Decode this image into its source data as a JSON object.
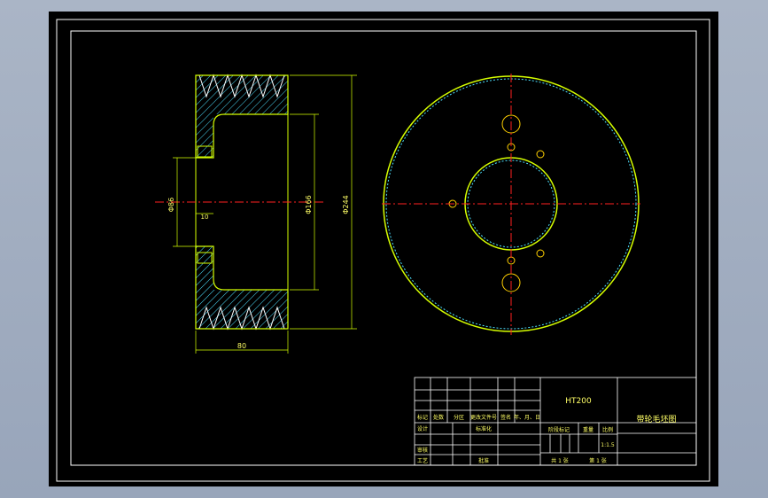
{
  "drawing": {
    "material": "HT200",
    "title": "带轮毛坯图",
    "scale": "1:1.5",
    "sheet_total": "共 1 张",
    "sheet_no": "第 1 张"
  },
  "dimensions": {
    "overall_diameter": "Φ244",
    "bore_diameter": "Φ166",
    "hub_diameter": "Φ86",
    "hub_offset": "10",
    "width": "80"
  },
  "title_block": {
    "mark": "标记",
    "count": "处数",
    "zone": "分区",
    "change_doc": "更改文件号",
    "signature": "签名",
    "date": "年、月、日",
    "design": "设计",
    "standardize": "标准化",
    "review": "审核",
    "process": "工艺",
    "approve": "批准",
    "stage_mark": "阶段标记",
    "weight": "重量",
    "ratio": "比例"
  },
  "colors": {
    "paper": "#000000",
    "frame": "#ffffff",
    "outline": "#d6ff00",
    "centerline": "#ff2020",
    "hatch": "#4de0ff",
    "hole": "#ffd000",
    "text": "#ffff66"
  }
}
